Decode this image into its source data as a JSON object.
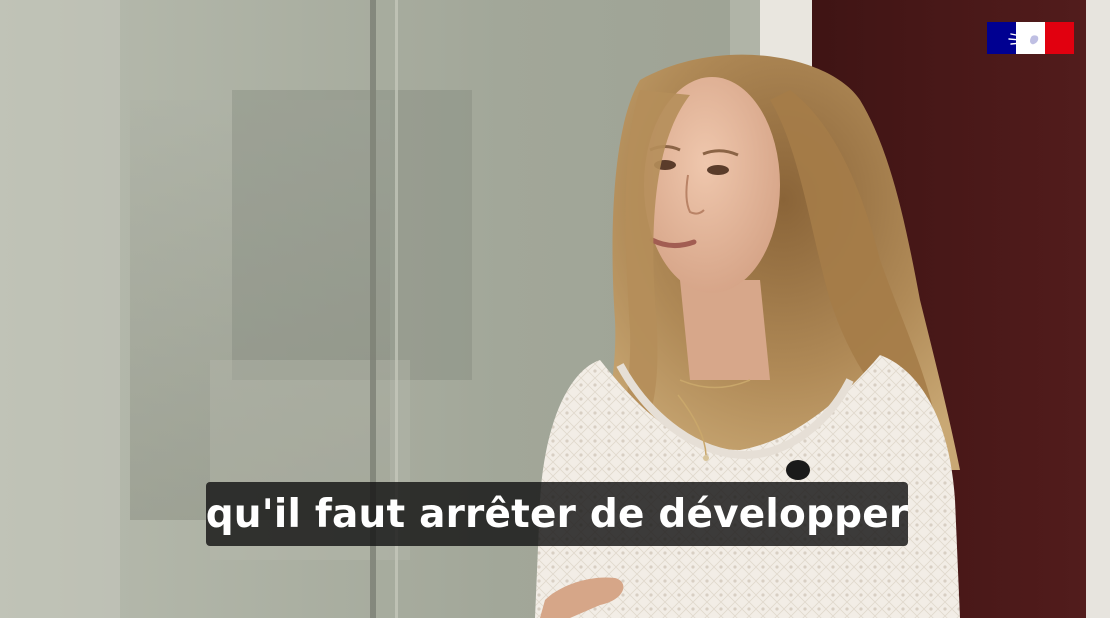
{
  "subtitle": {
    "text": "qu'il faut arrêter de développer"
  },
  "logo": {
    "name": "republique-francaise-marianne-logo",
    "colors": [
      "#000091",
      "#ffffff",
      "#e1000f"
    ]
  },
  "scene": {
    "description_colors": {
      "wall_left": "#a3a89a",
      "glass_panel": "#8f9486",
      "door_dark_red": "#4a1818",
      "hair": "#a9824f",
      "skin": "#e2b49b",
      "sweater": "#f1ece6"
    }
  }
}
